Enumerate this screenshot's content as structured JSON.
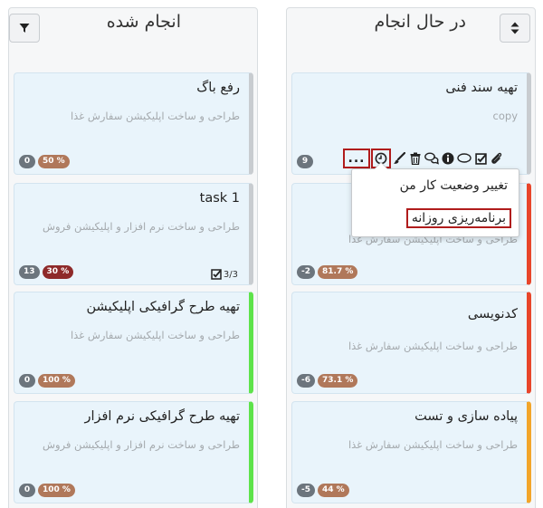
{
  "colors": {
    "border_gray": "#c8ccd0",
    "border_green": "#5ee34a",
    "border_red": "#e8452a",
    "border_orange": "#f2a52a",
    "highlight": "#b01c1c"
  },
  "columns": [
    {
      "id": "done",
      "title": "انجام شده",
      "header_icon": "filter-icon",
      "cards": [
        {
          "title": "رفع باگ",
          "desc": "طراحی و ساخت اپلیکیشن سفارش غذا",
          "count": "0",
          "pct": "50 %",
          "accent": "#c8ccd0"
        },
        {
          "title": "task 1",
          "desc": "طراحی و ساخت نرم افزار و اپلیکیشن فروش",
          "count": "13",
          "pct": "30 %",
          "accent": "#c8ccd0",
          "checklist": "3/3"
        },
        {
          "title": "تهیه طرح گرافیکی اپلیکیشن",
          "desc": "طراحی و ساخت اپلیکیشن سفارش غذا",
          "count": "0",
          "pct": "100 %",
          "accent": "#5ee34a"
        },
        {
          "title": "تهیه طرح گرافیکی نرم افزار",
          "desc": "طراحی و ساخت نرم افزار و اپلیکیشن فروش",
          "count": "0",
          "pct": "100 %",
          "accent": "#5ee34a"
        }
      ]
    },
    {
      "id": "progress",
      "title": "در حال انجام",
      "header_icon": "sort-icon",
      "cards": [
        {
          "title": "تهیه سند فنی",
          "desc": "copy",
          "count": "9",
          "pct": "",
          "accent": "#c8ccd0"
        },
        {
          "title": "",
          "desc": "طراحی و ساخت اپلیکیشن سفارش غذا",
          "count": "-2",
          "pct": "81.7 %",
          "accent": "#e8452a"
        },
        {
          "title": "کدنویسی",
          "desc": "طراحی و ساخت اپلیکیشن سفارش غذا",
          "count": "-6",
          "pct": "73.1 %",
          "accent": "#e8452a"
        },
        {
          "title": "پیاده سازی و تست",
          "desc": "طراحی و ساخت اپلیکیشن سفارش غذا",
          "count": "-5",
          "pct": "44 %",
          "accent": "#f2a52a"
        }
      ]
    }
  ],
  "toolbar": {
    "icons": [
      "more-dots-icon",
      "clock-icon",
      "brush-icon",
      "trash-icon",
      "comments-icon",
      "info-icon",
      "comment-icon",
      "checkbox-icon",
      "paperclip-icon"
    ],
    "more_label": "..."
  },
  "dropdown": {
    "items": [
      "تغییر وضعیت کار من",
      "برنامه‌ریزی روزانه"
    ]
  }
}
